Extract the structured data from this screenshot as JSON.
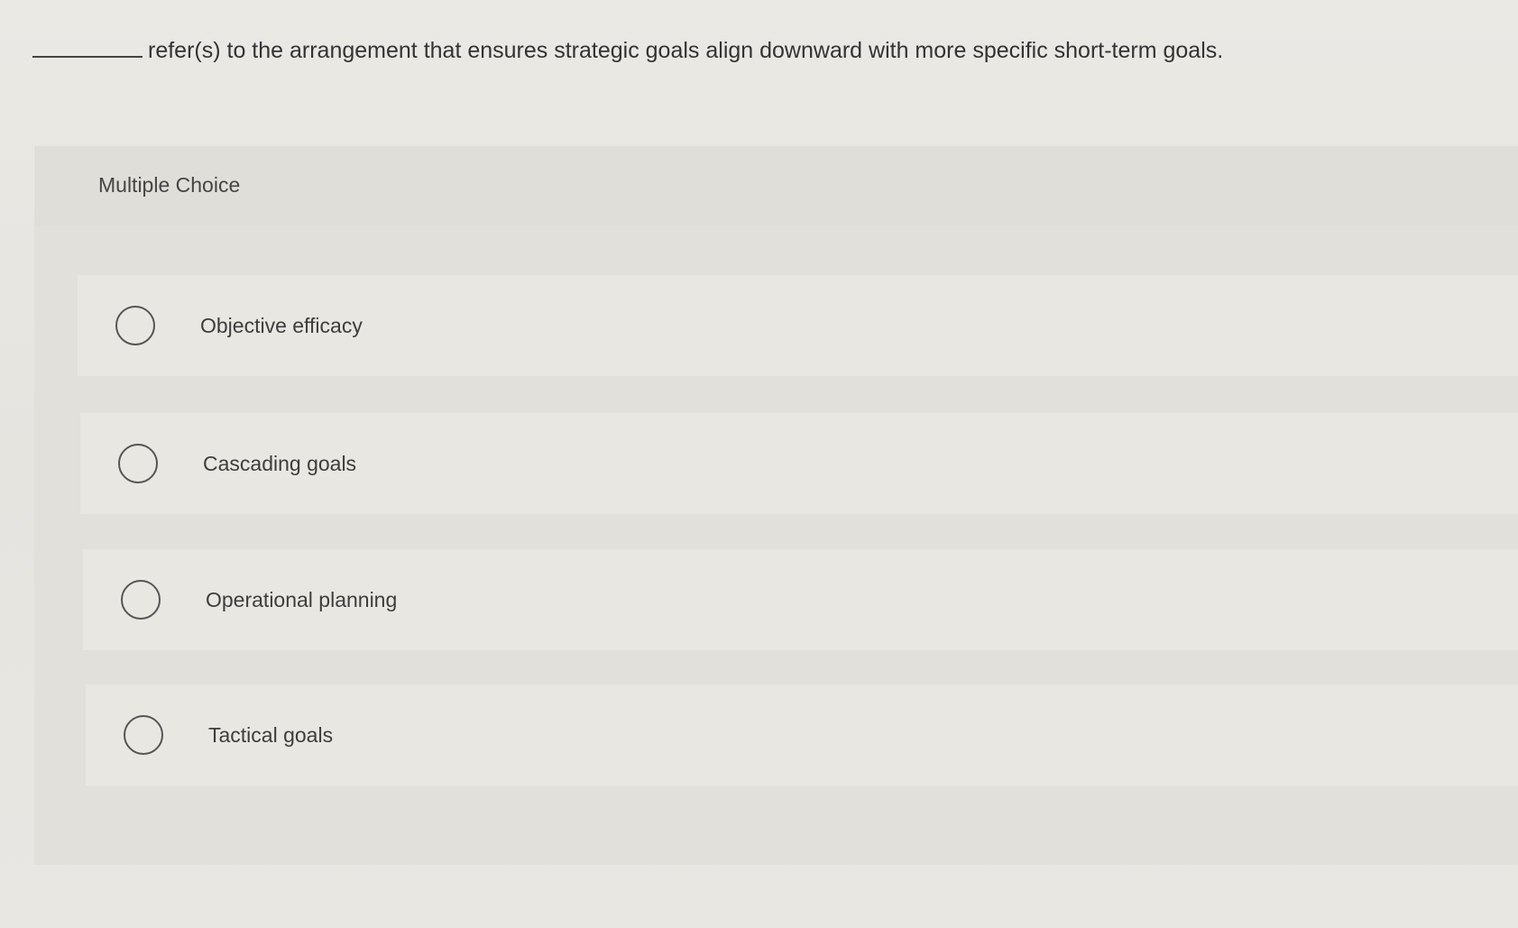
{
  "question": {
    "text": "refer(s) to the arrangement that ensures strategic goals align downward with more specific short-term goals."
  },
  "panel": {
    "title": "Multiple Choice"
  },
  "choices": [
    {
      "label": "Objective efficacy"
    },
    {
      "label": "Cascading goals"
    },
    {
      "label": "Operational planning"
    },
    {
      "label": "Tactical goals"
    }
  ],
  "colors": {
    "background": "#e9e7e2",
    "panel": "#e2e0da",
    "text": "#3a3a3a"
  }
}
